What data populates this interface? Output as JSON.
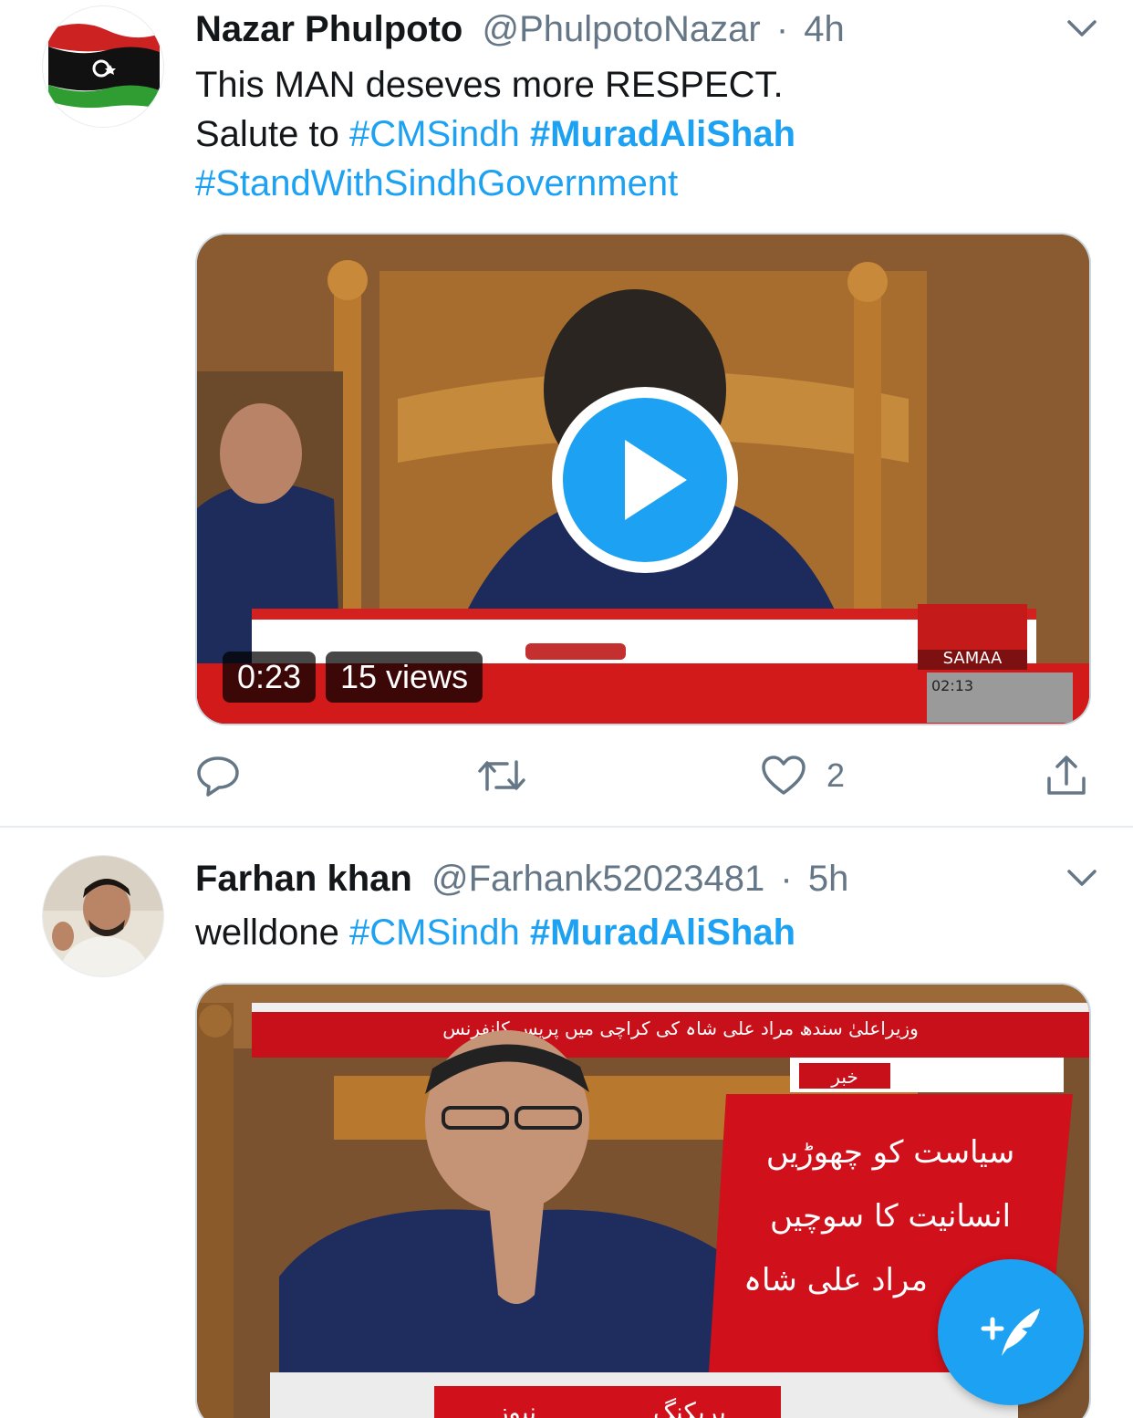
{
  "tweets": [
    {
      "name": "Nazar Phulpoto",
      "handle": "@PhulpotoNazar",
      "separator": "·",
      "time": "4h",
      "line1": "This MAN deseves more RESPECT.",
      "line2_prefix": "Salute to ",
      "tag1": "#CMSindh",
      "tag2": "#MuradAliShah",
      "tag3": "#StandWithSindhGovernment",
      "video": {
        "duration": "0:23",
        "views": "15 views",
        "channel": "SAMAA",
        "clock": "02:13"
      },
      "actions": {
        "likes": "2"
      },
      "icons": [
        "reply-icon",
        "retweet-icon",
        "like-icon",
        "share-icon",
        "chevron-down-icon",
        "play-icon"
      ]
    },
    {
      "name": "Farhan khan",
      "handle": "@Farhank52023481",
      "separator": "·",
      "time": "5h",
      "text_prefix": "welldone ",
      "tag1": "#CMSindh",
      "tag2": "#MuradAliShah",
      "image": {
        "ticker": "وزیراعلیٰ سندھ مراد علی شاہ کی کراچی میں پریس کانفرنس",
        "news_label": "خبر",
        "line1": "سیاست کو چھوڑیں",
        "line2": "انسانیت کا سوچیں",
        "line3": "مراد علی شاہ",
        "breaking": "بریکنگ",
        "news": "نیوز"
      }
    }
  ],
  "fab": {
    "icon": "compose-tweet-icon"
  },
  "colors": {
    "accent": "#1da1f2",
    "text": "#14171a",
    "muted": "#657786",
    "divider": "#e6ecf0",
    "news_red": "#d0101b"
  }
}
